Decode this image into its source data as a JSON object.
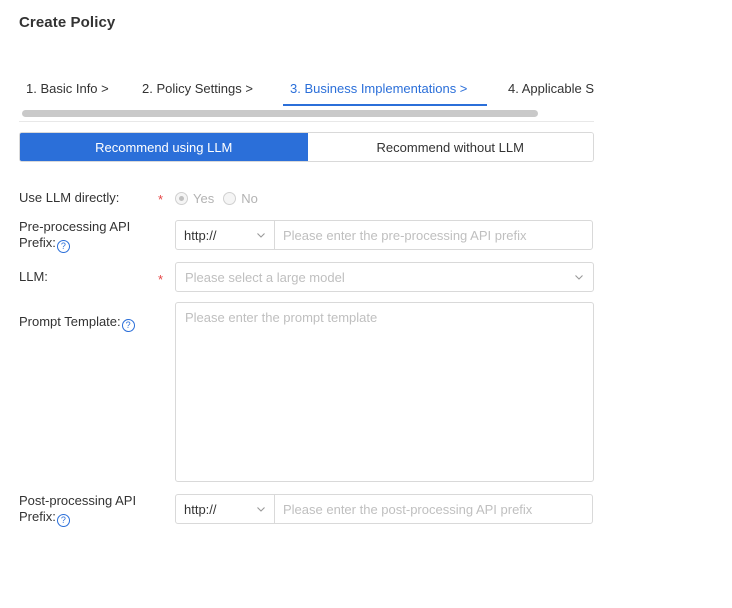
{
  "page": {
    "title": "Create Policy"
  },
  "steps": [
    {
      "label": "1. Basic Info >"
    },
    {
      "label": "2. Policy Settings >"
    },
    {
      "label": "3. Business Implementations >"
    },
    {
      "label": "4. Applicable S"
    }
  ],
  "active_step": 2,
  "mode_toggle": {
    "with_llm": "Recommend using LLM",
    "without_llm": "Recommend without LLM",
    "selected": "with_llm"
  },
  "form": {
    "use_llm": {
      "label": "Use LLM directly:",
      "required_mark": "*",
      "yes": "Yes",
      "no": "No",
      "selected": "Yes"
    },
    "pre_api": {
      "label_line1": "Pre-processing API",
      "label_line2": "Prefix:",
      "prefix": "http://",
      "placeholder": "Please enter the pre-processing API prefix"
    },
    "llm": {
      "label": "LLM:",
      "required_mark": "*",
      "placeholder": "Please select a large model"
    },
    "prompt": {
      "label": "Prompt Template:",
      "placeholder": "Please enter the prompt template"
    },
    "post_api": {
      "label_line1": "Post-processing API",
      "label_line2": "Prefix:",
      "prefix": "http://",
      "placeholder": "Please enter the post-processing API prefix"
    },
    "help_glyph": "?"
  },
  "colors": {
    "accent": "#2b6fd9",
    "required": "#e54545",
    "placeholder": "#bfbfbf",
    "border": "#d9d9d9"
  }
}
